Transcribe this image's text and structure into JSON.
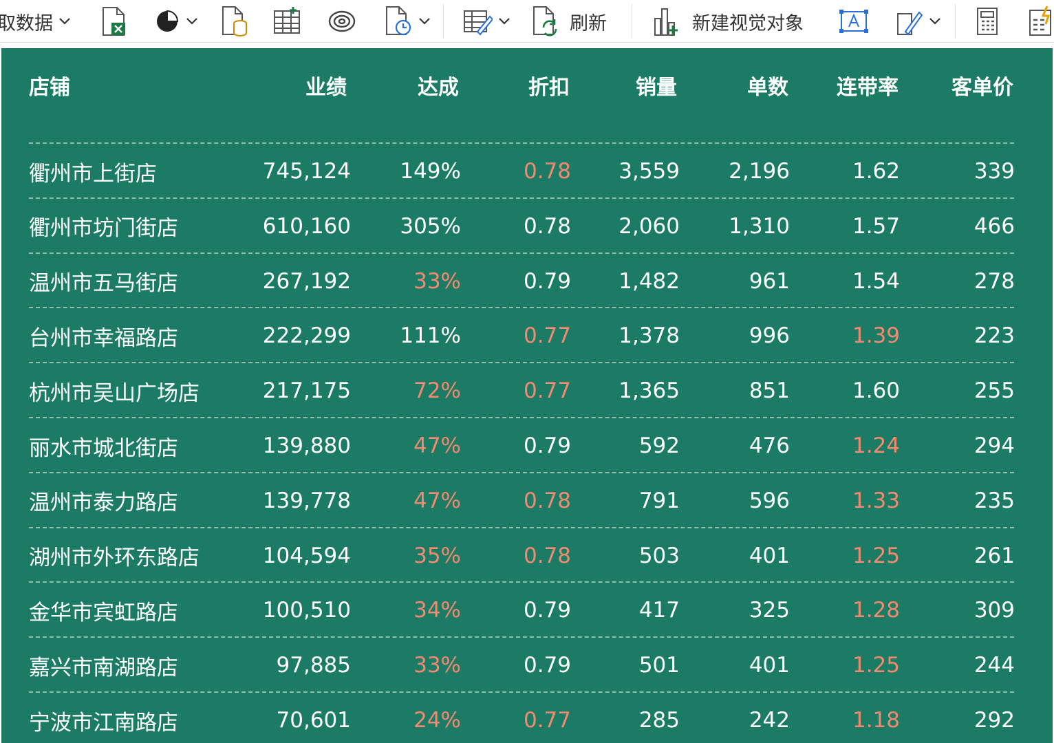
{
  "toolbar": {
    "get_data_label": "取数据",
    "refresh_label": "刷新",
    "new_visual_label": "新建视觉对象"
  },
  "colors": {
    "report_bg": "#1b7b64",
    "text": "#ffffff",
    "highlight": "#f08a70",
    "separator": "#8fbfb1"
  },
  "table": {
    "columns": [
      "店铺",
      "业绩",
      "达成",
      "折扣",
      "销量",
      "单数",
      "连带率",
      "客单价"
    ],
    "rows": [
      {
        "store": "衢州市上街店",
        "sales": "745,124",
        "achieve": "149%",
        "discount": "0.78",
        "volume": "3,559",
        "orders": "2,196",
        "attach": "1.62",
        "aov": "339",
        "achieve_hl": false,
        "discount_hl": true,
        "attach_hl": false
      },
      {
        "store": "衢州市坊门街店",
        "sales": "610,160",
        "achieve": "305%",
        "discount": "0.78",
        "volume": "2,060",
        "orders": "1,310",
        "attach": "1.57",
        "aov": "466",
        "achieve_hl": false,
        "discount_hl": false,
        "attach_hl": false
      },
      {
        "store": "温州市五马街店",
        "sales": "267,192",
        "achieve": "33%",
        "discount": "0.79",
        "volume": "1,482",
        "orders": "961",
        "attach": "1.54",
        "aov": "278",
        "achieve_hl": true,
        "discount_hl": false,
        "attach_hl": false
      },
      {
        "store": "台州市幸福路店",
        "sales": "222,299",
        "achieve": "111%",
        "discount": "0.77",
        "volume": "1,378",
        "orders": "996",
        "attach": "1.39",
        "aov": "223",
        "achieve_hl": false,
        "discount_hl": true,
        "attach_hl": true
      },
      {
        "store": "杭州市吴山广场店",
        "sales": "217,175",
        "achieve": "72%",
        "discount": "0.77",
        "volume": "1,365",
        "orders": "851",
        "attach": "1.60",
        "aov": "255",
        "achieve_hl": true,
        "discount_hl": true,
        "attach_hl": false
      },
      {
        "store": "丽水市城北街店",
        "sales": "139,880",
        "achieve": "47%",
        "discount": "0.79",
        "volume": "592",
        "orders": "476",
        "attach": "1.24",
        "aov": "294",
        "achieve_hl": true,
        "discount_hl": false,
        "attach_hl": true
      },
      {
        "store": "温州市泰力路店",
        "sales": "139,778",
        "achieve": "47%",
        "discount": "0.78",
        "volume": "791",
        "orders": "596",
        "attach": "1.33",
        "aov": "235",
        "achieve_hl": true,
        "discount_hl": true,
        "attach_hl": true
      },
      {
        "store": "湖州市外环东路店",
        "sales": "104,594",
        "achieve": "35%",
        "discount": "0.78",
        "volume": "503",
        "orders": "401",
        "attach": "1.25",
        "aov": "261",
        "achieve_hl": true,
        "discount_hl": true,
        "attach_hl": true
      },
      {
        "store": "金华市宾虹路店",
        "sales": "100,510",
        "achieve": "34%",
        "discount": "0.79",
        "volume": "417",
        "orders": "325",
        "attach": "1.28",
        "aov": "309",
        "achieve_hl": true,
        "discount_hl": false,
        "attach_hl": true
      },
      {
        "store": "嘉兴市南湖路店",
        "sales": "97,885",
        "achieve": "33%",
        "discount": "0.79",
        "volume": "501",
        "orders": "401",
        "attach": "1.25",
        "aov": "244",
        "achieve_hl": true,
        "discount_hl": false,
        "attach_hl": true
      },
      {
        "store": "宁波市江南路店",
        "sales": "70,601",
        "achieve": "24%",
        "discount": "0.77",
        "volume": "285",
        "orders": "242",
        "attach": "1.18",
        "aov": "292",
        "achieve_hl": true,
        "discount_hl": true,
        "attach_hl": true
      }
    ]
  }
}
